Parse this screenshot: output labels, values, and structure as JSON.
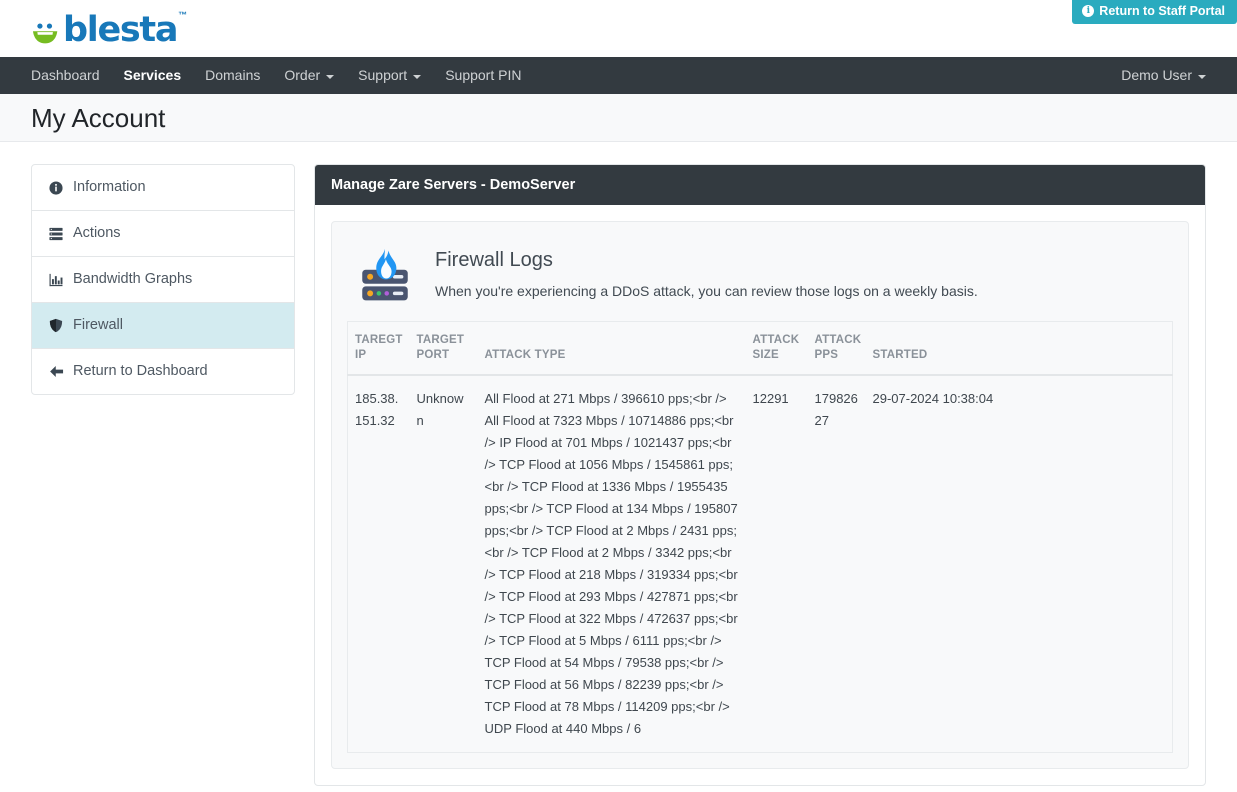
{
  "brand": {
    "name": "blesta",
    "tm": "™",
    "color": "#1878b9",
    "accent_green": "#76bc21"
  },
  "topbar": {
    "staff_portal_button": "Return to Staff Portal",
    "staff_portal_icon": "info-circle-icon",
    "staff_portal_color": "#2aabbf"
  },
  "navbar": {
    "items": [
      {
        "label": "Dashboard",
        "active": false,
        "caret": false
      },
      {
        "label": "Services",
        "active": true,
        "caret": false
      },
      {
        "label": "Domains",
        "active": false,
        "caret": false
      },
      {
        "label": "Order",
        "active": false,
        "caret": true
      },
      {
        "label": "Support",
        "active": false,
        "caret": true
      },
      {
        "label": "Support PIN",
        "active": false,
        "caret": false
      }
    ],
    "user": "Demo User",
    "user_caret": true
  },
  "page": {
    "title": "My Account"
  },
  "sidebar": {
    "items": [
      {
        "label": "Information",
        "icon": "info-circle-icon",
        "active": false
      },
      {
        "label": "Actions",
        "icon": "server-stack-icon",
        "active": false
      },
      {
        "label": "Bandwidth Graphs",
        "icon": "bar-chart-icon",
        "active": false
      },
      {
        "label": "Firewall",
        "icon": "shield-icon",
        "active": true
      },
      {
        "label": "Return to Dashboard",
        "icon": "arrow-left-icon",
        "active": false
      }
    ]
  },
  "panel": {
    "header": "Manage Zare Servers - DemoServer",
    "firewall": {
      "icon": "server-flame-icon",
      "title": "Firewall Logs",
      "description": "When you're experiencing a DDoS attack, you can review those logs on a weekly basis."
    },
    "table": {
      "columns": [
        "TAREGT IP",
        "TARGET PORT",
        "ATTACK TYPE",
        "ATTACK SIZE",
        "ATTACK PPS",
        "STARTED"
      ],
      "rows": [
        {
          "target_ip": "185.38.151.32",
          "target_port": "Unknown",
          "attack_type": "All Flood at 271 Mbps / 396610 pps;<br /> All Flood at 7323 Mbps / 10714886 pps;<br /> IP Flood at 701 Mbps / 1021437 pps;<br /> TCP Flood at 1056 Mbps / 1545861 pps;<br /> TCP Flood at 1336 Mbps / 1955435 pps;<br /> TCP Flood at 134 Mbps / 195807 pps;<br /> TCP Flood at 2 Mbps / 2431 pps;<br /> TCP Flood at 2 Mbps / 3342 pps;<br /> TCP Flood at 218 Mbps / 319334 pps;<br /> TCP Flood at 293 Mbps / 427871 pps;<br /> TCP Flood at 322 Mbps / 472637 pps;<br /> TCP Flood at 5 Mbps / 6111 pps;<br /> TCP Flood at 54 Mbps / 79538 pps;<br /> TCP Flood at 56 Mbps / 82239 pps;<br /> TCP Flood at 78 Mbps / 114209 pps;<br /> UDP Flood at 440 Mbps / 6",
          "attack_size": "12291",
          "attack_pps": "17982627",
          "started": "29-07-2024 10:38:04"
        }
      ]
    }
  }
}
